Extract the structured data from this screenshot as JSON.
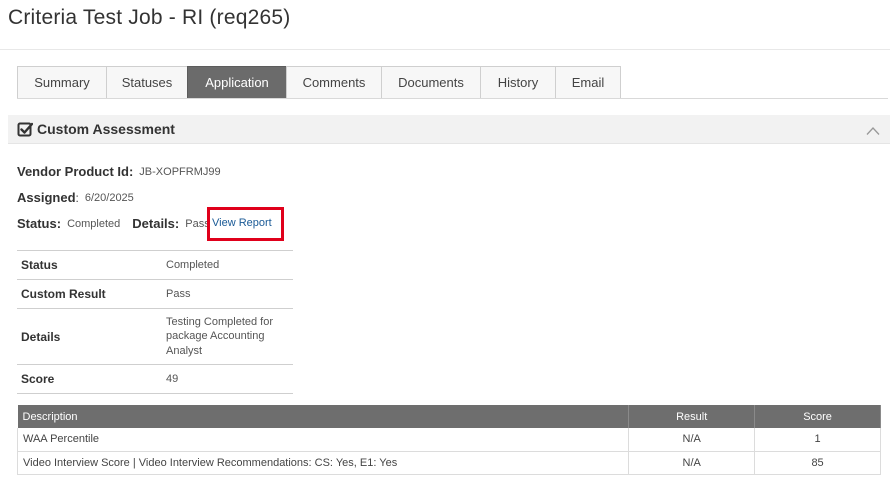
{
  "page": {
    "title": "Criteria Test Job - RI (req265)"
  },
  "tabs": [
    {
      "label": "Summary",
      "active": false
    },
    {
      "label": "Statuses",
      "active": false
    },
    {
      "label": "Application",
      "active": true
    },
    {
      "label": "Comments",
      "active": false
    },
    {
      "label": "Documents",
      "active": false
    },
    {
      "label": "History",
      "active": false
    },
    {
      "label": "Email",
      "active": false
    }
  ],
  "section": {
    "title": "Custom Assessment",
    "icon": "checkbox-checked-icon",
    "collapse_icon": "chevron-up-icon"
  },
  "info": {
    "vendor_label": "Vendor Product Id:",
    "vendor_value": "JB-XOPFRMJ99",
    "assigned_label": "Assigned",
    "assigned_colon": ":",
    "assigned_value": "6/20/2025",
    "status_label": "Status:",
    "status_value": "Completed",
    "details_label": "Details:",
    "details_value": "Pass",
    "view_report": "View Report"
  },
  "detail_rows": [
    {
      "key": "Status",
      "value": "Completed"
    },
    {
      "key": "Custom Result",
      "value": "Pass"
    },
    {
      "key": "Details",
      "value": "Testing Completed for package Accounting Analyst"
    },
    {
      "key": "Score",
      "value": "49"
    }
  ],
  "score_table": {
    "headers": [
      "Description",
      "Result",
      "Score"
    ],
    "rows": [
      [
        "WAA Percentile",
        "N/A",
        "1"
      ],
      [
        "Video Interview Score | Video Interview Recommendations: CS: Yes, E1: Yes",
        "N/A",
        "85"
      ]
    ]
  },
  "colors": {
    "active_tab": "#6b6b6b",
    "highlight_box": "#e0001b",
    "link": "#1a5a96",
    "table_header": "#6e6e6e"
  }
}
